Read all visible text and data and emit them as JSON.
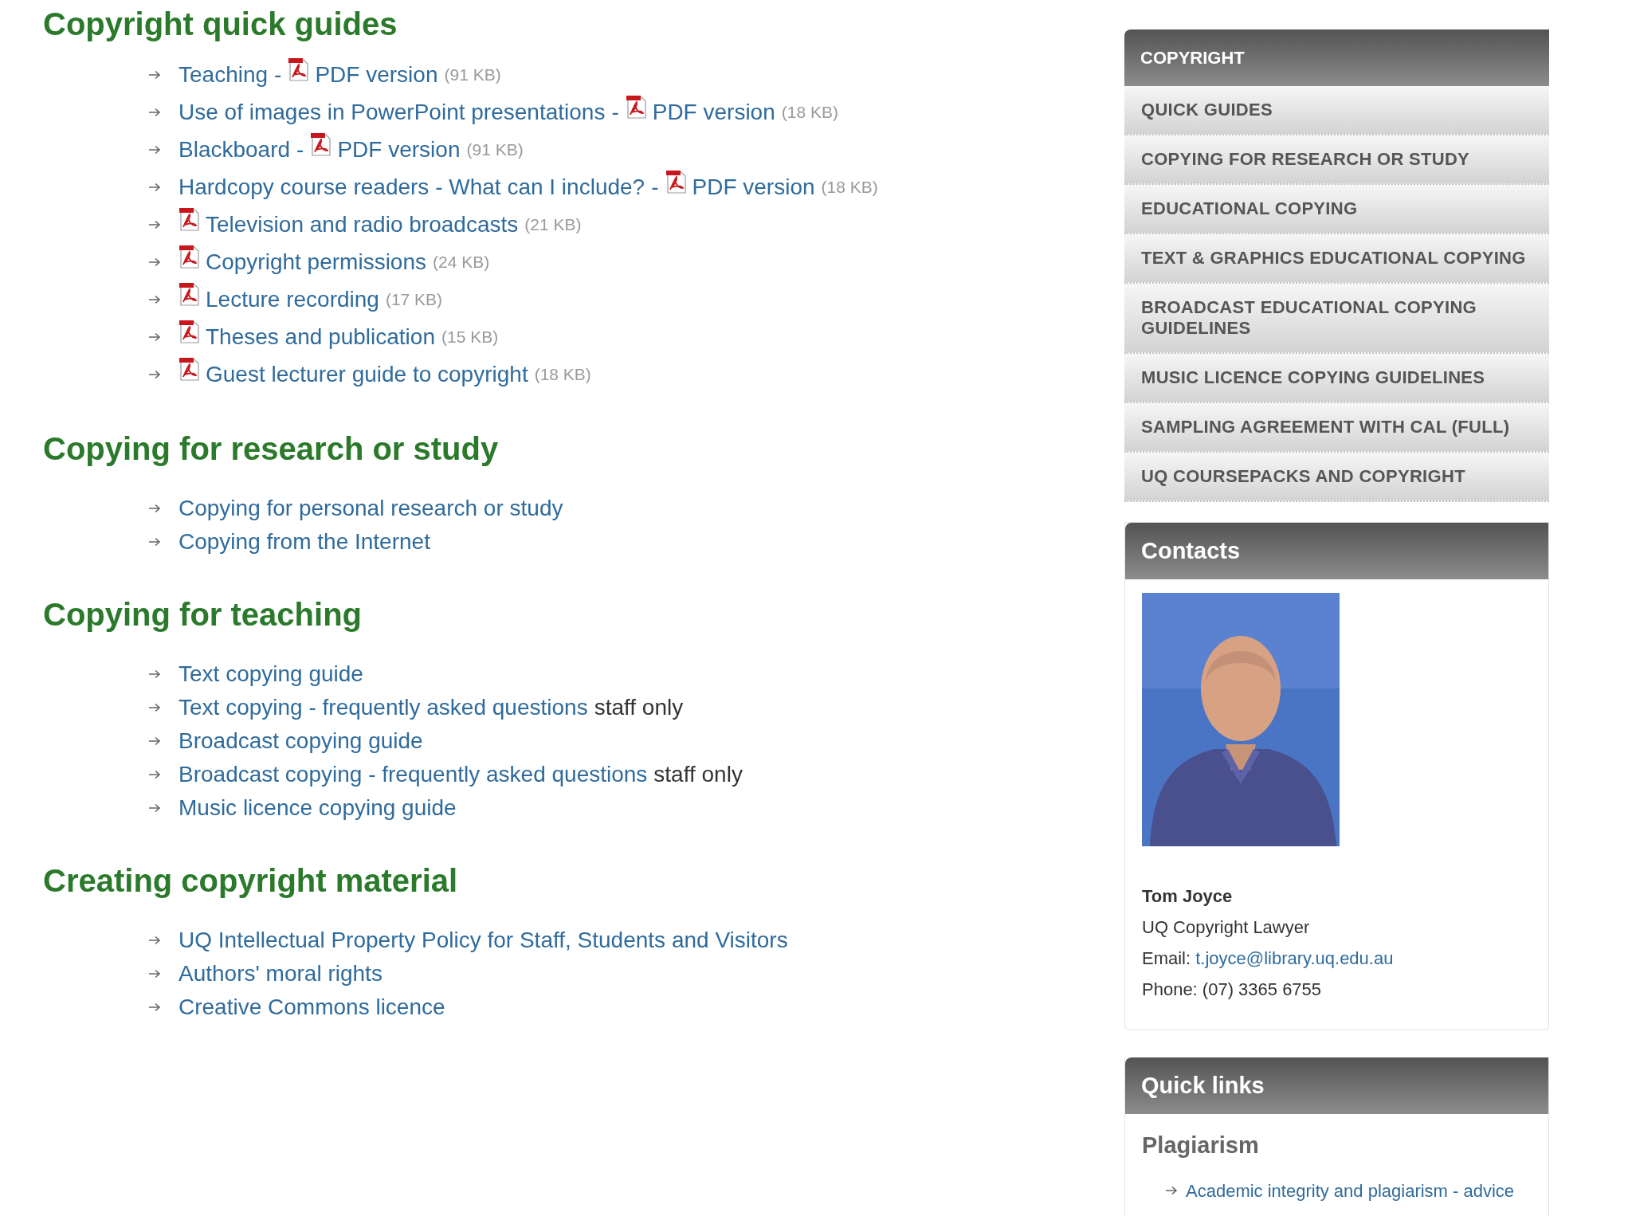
{
  "sections": [
    {
      "heading": "Copyright quick guides",
      "items": [
        {
          "parts": [
            {
              "kind": "link",
              "text": "Teaching"
            },
            {
              "kind": "sep",
              "text": "-"
            },
            {
              "kind": "pdf"
            },
            {
              "kind": "link",
              "text": "PDF version"
            },
            {
              "kind": "size",
              "text": "(91 KB)"
            }
          ]
        },
        {
          "parts": [
            {
              "kind": "link",
              "text": "Use of images in PowerPoint presentations"
            },
            {
              "kind": "sep",
              "text": "-"
            },
            {
              "kind": "pdf"
            },
            {
              "kind": "link",
              "text": "PDF version"
            },
            {
              "kind": "size",
              "text": "(18 KB)"
            }
          ]
        },
        {
          "parts": [
            {
              "kind": "link",
              "text": "Blackboard"
            },
            {
              "kind": "sep",
              "text": "-"
            },
            {
              "kind": "pdf"
            },
            {
              "kind": "link",
              "text": "PDF version"
            },
            {
              "kind": "size",
              "text": "(91 KB)"
            }
          ]
        },
        {
          "parts": [
            {
              "kind": "link",
              "text": "Hardcopy course readers - What can I include?"
            },
            {
              "kind": "sep",
              "text": "-"
            },
            {
              "kind": "pdf"
            },
            {
              "kind": "link",
              "text": "PDF version"
            },
            {
              "kind": "size",
              "text": "(18 KB)"
            }
          ]
        },
        {
          "parts": [
            {
              "kind": "pdf"
            },
            {
              "kind": "link",
              "text": "Television and radio broadcasts"
            },
            {
              "kind": "size",
              "text": "(21 KB)"
            }
          ]
        },
        {
          "parts": [
            {
              "kind": "pdf"
            },
            {
              "kind": "link",
              "text": "Copyright permissions"
            },
            {
              "kind": "size",
              "text": "(24 KB)"
            }
          ]
        },
        {
          "parts": [
            {
              "kind": "pdf"
            },
            {
              "kind": "link",
              "text": "Lecture recording"
            },
            {
              "kind": "size",
              "text": "(17 KB)"
            }
          ]
        },
        {
          "parts": [
            {
              "kind": "pdf"
            },
            {
              "kind": "link",
              "text": "Theses and publication"
            },
            {
              "kind": "size",
              "text": "(15 KB)"
            }
          ]
        },
        {
          "parts": [
            {
              "kind": "pdf"
            },
            {
              "kind": "link",
              "text": "Guest lecturer guide to copyright"
            },
            {
              "kind": "size",
              "text": "(18 KB)"
            }
          ]
        }
      ]
    },
    {
      "heading": "Copying for research or study",
      "items": [
        {
          "parts": [
            {
              "kind": "link",
              "text": "Copying for personal research or study"
            }
          ]
        },
        {
          "parts": [
            {
              "kind": "link",
              "text": "Copying from the Internet"
            }
          ]
        }
      ]
    },
    {
      "heading": "Copying for teaching",
      "items": [
        {
          "parts": [
            {
              "kind": "link",
              "text": "Text copying guide"
            }
          ]
        },
        {
          "parts": [
            {
              "kind": "link",
              "text": "Text copying - frequently asked questions"
            },
            {
              "kind": "note",
              "text": "staff only"
            }
          ]
        },
        {
          "parts": [
            {
              "kind": "link",
              "text": "Broadcast copying guide"
            }
          ]
        },
        {
          "parts": [
            {
              "kind": "link",
              "text": "Broadcast copying - frequently asked questions"
            },
            {
              "kind": "note",
              "text": "staff only"
            }
          ]
        },
        {
          "parts": [
            {
              "kind": "link",
              "text": "Music licence copying guide"
            }
          ]
        }
      ]
    },
    {
      "heading": "Creating copyright material",
      "items": [
        {
          "parts": [
            {
              "kind": "link",
              "text": "UQ Intellectual Property Policy for Staff, Students and Visitors"
            }
          ]
        },
        {
          "parts": [
            {
              "kind": "link",
              "text": "Authors' moral rights"
            }
          ]
        },
        {
          "parts": [
            {
              "kind": "link",
              "text": "Creative Commons licence"
            }
          ]
        }
      ]
    }
  ],
  "sidebar": {
    "nav": {
      "title": "COPYRIGHT",
      "items": [
        {
          "label": "QUICK GUIDES"
        },
        {
          "label": "COPYING FOR RESEARCH OR STUDY"
        },
        {
          "label": "EDUCATIONAL COPYING"
        },
        {
          "label": "TEXT & GRAPHICS EDUCATIONAL COPYING"
        },
        {
          "label": "BROADCAST EDUCATIONAL COPYING GUIDELINES"
        },
        {
          "label": "MUSIC LICENCE COPYING GUIDELINES"
        },
        {
          "label": "SAMPLING AGREEMENT WITH CAL (FULL)"
        },
        {
          "label": "UQ COURSEPACKS AND COPYRIGHT"
        }
      ]
    },
    "contacts": {
      "title": "Contacts",
      "name": "Tom Joyce",
      "role": "UQ Copyright Lawyer",
      "email_label": "Email:",
      "email": "t.joyce@library.uq.edu.au",
      "phone": "Phone: (07) 3365 6755"
    },
    "quick_links": {
      "title": "Quick links",
      "subheading": "Plagiarism",
      "links": [
        "Academic integrity and plagiarism - advice"
      ]
    }
  }
}
